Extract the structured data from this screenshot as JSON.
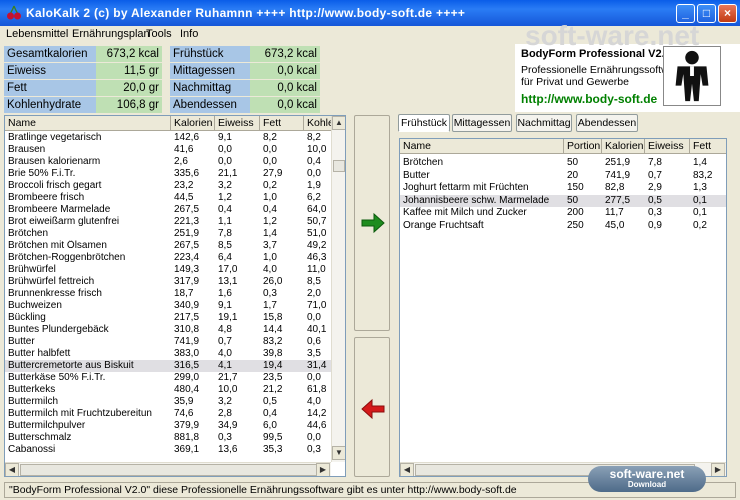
{
  "window": {
    "title": "KaloKalk 2 (c) by Alexander Ruhamnn ++++ http://www.body-soft.de ++++"
  },
  "menu": [
    "Lebensmittel",
    "Ernährungsplan",
    "Tools",
    "Info"
  ],
  "totals": {
    "left": [
      {
        "label": "Gesamtkalorien",
        "value": "673,2 kcal"
      },
      {
        "label": "Eiweiss",
        "value": "11,5 gr"
      },
      {
        "label": "Fett",
        "value": "20,0 gr"
      },
      {
        "label": "Kohlenhydrate",
        "value": "106,8 gr"
      }
    ],
    "right": [
      {
        "label": "Frühstück",
        "value": "673,2 kcal"
      },
      {
        "label": "Mittagessen",
        "value": "0,0 kcal"
      },
      {
        "label": "Nachmittag",
        "value": "0,0 kcal"
      },
      {
        "label": "Abendessen",
        "value": "0,0 kcal"
      }
    ]
  },
  "logo": {
    "brand": "soft-ware.net",
    "title": "BodyForm Professional V2.0",
    "line1": "Professionelle Ernährungssoftware",
    "line2": "für Privat und Gewerbe",
    "url": "http://www.body-soft.de"
  },
  "food_table": {
    "columns": [
      "Name",
      "Kalorien",
      "Eiweiss",
      "Fett",
      "Kohle"
    ],
    "selected_index": 19,
    "rows": [
      [
        "Bratlinge vegetarisch",
        "142,6",
        "9,1",
        "8,2",
        "8,2"
      ],
      [
        "Brausen",
        "41,6",
        "0,0",
        "0,0",
        "10,0"
      ],
      [
        "Brausen kalorienarm",
        "2,6",
        "0,0",
        "0,0",
        "0,4"
      ],
      [
        "Brie 50% F.i.Tr.",
        "335,6",
        "21,1",
        "27,9",
        "0,0"
      ],
      [
        "Broccoli frisch gegart",
        "23,2",
        "3,2",
        "0,2",
        "1,9"
      ],
      [
        "Brombeere frisch",
        "44,5",
        "1,2",
        "1,0",
        "6,2"
      ],
      [
        "Brombeere Marmelade",
        "267,5",
        "0,4",
        "0,4",
        "64,0"
      ],
      [
        "Brot eiweißarm glutenfrei",
        "221,3",
        "1,1",
        "1,2",
        "50,7"
      ],
      [
        "Brötchen",
        "251,9",
        "7,8",
        "1,4",
        "51,0"
      ],
      [
        "Brötchen mit Ölsamen",
        "267,5",
        "8,5",
        "3,7",
        "49,2"
      ],
      [
        "Brötchen-Roggenbrötchen",
        "223,4",
        "6,4",
        "1,0",
        "46,3"
      ],
      [
        "Brühwürfel",
        "149,3",
        "17,0",
        "4,0",
        "11,0"
      ],
      [
        "Brühwürfel fettreich",
        "317,9",
        "13,1",
        "26,0",
        "8,5"
      ],
      [
        "Brunnenkresse frisch",
        "18,7",
        "1,6",
        "0,3",
        "2,0"
      ],
      [
        "Buchweizen",
        "340,9",
        "9,1",
        "1,7",
        "71,0"
      ],
      [
        "Bückling",
        "217,5",
        "19,1",
        "15,8",
        "0,0"
      ],
      [
        "Buntes Plundergebäck",
        "310,8",
        "4,8",
        "14,4",
        "40,1"
      ],
      [
        "Butter",
        "741,9",
        "0,7",
        "83,2",
        "0,6"
      ],
      [
        "Butter halbfett",
        "383,0",
        "4,0",
        "39,8",
        "3,5"
      ],
      [
        "Buttercremetorte aus Biskuit",
        "316,5",
        "4,1",
        "19,4",
        "31,4"
      ],
      [
        "Butterkäse 50% F.i.Tr.",
        "299,0",
        "21,7",
        "23,5",
        "0,0"
      ],
      [
        "Butterkeks",
        "480,4",
        "10,0",
        "21,2",
        "61,8"
      ],
      [
        "Buttermilch",
        "35,9",
        "3,2",
        "0,5",
        "4,0"
      ],
      [
        "Buttermilch mit Fruchtzubereitun",
        "74,6",
        "2,8",
        "0,4",
        "14,2"
      ],
      [
        "Buttermilchpulver",
        "379,9",
        "34,9",
        "6,0",
        "44,6"
      ],
      [
        "Butterschmalz",
        "881,8",
        "0,3",
        "99,5",
        "0,0"
      ],
      [
        "Cabanossi",
        "369,1",
        "13,6",
        "35,3",
        "0,3"
      ]
    ]
  },
  "tabs": [
    "Frühstück",
    "Mittagessen",
    "Nachmittag",
    "Abendessen"
  ],
  "meal_table": {
    "columns": [
      "Name",
      "Portion",
      "Kalorien",
      "Eiweiss",
      "Fett"
    ],
    "rows": [
      [
        "Brötchen",
        "50",
        "251,9",
        "7,8",
        "1,4"
      ],
      [
        "Butter",
        "20",
        "741,9",
        "0,7",
        "83,2"
      ],
      [
        "Joghurt fettarm mit Früchten",
        "150",
        "82,8",
        "2,9",
        "1,3"
      ],
      [
        "Johannisbeere schw. Marmelade",
        "50",
        "277,5",
        "0,5",
        "0,1"
      ],
      [
        "Kaffee mit Milch und Zucker",
        "200",
        "11,7",
        "0,3",
        "0,1"
      ],
      [
        "Orange Fruchtsaft",
        "250",
        "45,0",
        "0,9",
        "0,2"
      ]
    ]
  },
  "status": "\"BodyForm Professional V2.0\" diese Professionelle Ernährungssoftware gibt es unter http://www.body-soft.de",
  "watermark": {
    "line1": "soft-ware.net",
    "line2": "Download"
  },
  "colors": {
    "title_bar": "#1556d8",
    "label_bg": "#a8c6e6",
    "value_bg": "#bfe0b4",
    "add_arrow": "#1e8c1e",
    "remove_arrow": "#d41a1a",
    "url_green": "#008000"
  }
}
